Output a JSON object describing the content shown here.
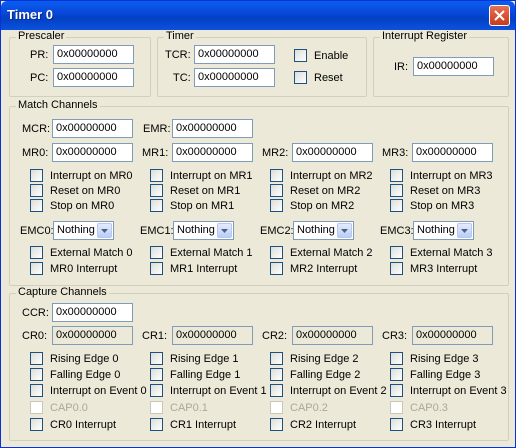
{
  "window": {
    "title": "Timer 0"
  },
  "prescaler": {
    "title": "Prescaler",
    "pr_label": "PR:",
    "pr_value": "0x00000000",
    "pc_label": "PC:",
    "pc_value": "0x00000000"
  },
  "timer": {
    "title": "Timer",
    "tcr_label": "TCR:",
    "tcr_value": "0x00000000",
    "tc_label": "TC:",
    "tc_value": "0x00000000",
    "enable_label": "Enable",
    "reset_label": "Reset"
  },
  "interrupt_register": {
    "title": "Interrupt Register",
    "ir_label": "IR:",
    "ir_value": "0x00000000"
  },
  "match": {
    "title": "Match Channels",
    "mcr_label": "MCR:",
    "mcr_value": "0x00000000",
    "emr_label": "EMR:",
    "emr_value": "0x00000000",
    "channels": [
      {
        "mr_label": "MR0:",
        "mr_value": "0x00000000",
        "int_label": "Interrupt on MR0",
        "reset_label": "Reset on MR0",
        "stop_label": "Stop on MR0",
        "emc_label": "EMC0:",
        "emc_value": "Nothing",
        "ext_label": "External Match 0",
        "mri_label": "MR0 Interrupt"
      },
      {
        "mr_label": "MR1:",
        "mr_value": "0x00000000",
        "int_label": "Interrupt on MR1",
        "reset_label": "Reset on MR1",
        "stop_label": "Stop on MR1",
        "emc_label": "EMC1:",
        "emc_value": "Nothing",
        "ext_label": "External Match 1",
        "mri_label": "MR1 Interrupt"
      },
      {
        "mr_label": "MR2:",
        "mr_value": "0x00000000",
        "int_label": "Interrupt on MR2",
        "reset_label": "Reset on MR2",
        "stop_label": "Stop on MR2",
        "emc_label": "EMC2:",
        "emc_value": "Nothing",
        "ext_label": "External Match 2",
        "mri_label": "MR2 Interrupt"
      },
      {
        "mr_label": "MR3:",
        "mr_value": "0x00000000",
        "int_label": "Interrupt on MR3",
        "reset_label": "Reset on MR3",
        "stop_label": "Stop on MR3",
        "emc_label": "EMC3:",
        "emc_value": "Nothing",
        "ext_label": "External Match 3",
        "mri_label": "MR3 Interrupt"
      }
    ]
  },
  "capture": {
    "title": "Capture Channels",
    "ccr_label": "CCR:",
    "ccr_value": "0x00000000",
    "channels": [
      {
        "cr_label": "CR0:",
        "cr_value": "0x00000000",
        "rise_label": "Rising Edge 0",
        "fall_label": "Falling Edge 0",
        "event_label": "Interrupt on Event 0",
        "cap_label": "CAP0.0",
        "cri_label": "CR0 Interrupt"
      },
      {
        "cr_label": "CR1:",
        "cr_value": "0x00000000",
        "rise_label": "Rising Edge 1",
        "fall_label": "Falling Edge 1",
        "event_label": "Interrupt on Event 1",
        "cap_label": "CAP0.1",
        "cri_label": "CR1 Interrupt"
      },
      {
        "cr_label": "CR2:",
        "cr_value": "0x00000000",
        "rise_label": "Rising Edge 2",
        "fall_label": "Falling Edge 2",
        "event_label": "Interrupt on Event 2",
        "cap_label": "CAP0.2",
        "cri_label": "CR2 Interrupt"
      },
      {
        "cr_label": "CR3:",
        "cr_value": "0x00000000",
        "rise_label": "Rising Edge 3",
        "fall_label": "Falling Edge 3",
        "event_label": "Interrupt on Event 3",
        "cap_label": "CAP0.3",
        "cri_label": "CR3 Interrupt"
      }
    ]
  },
  "colors": {
    "title_bar": "#0846d6",
    "dialog_bg": "#ece9d8",
    "close_button": "#c93b1a",
    "disabled_text": "#aca899"
  },
  "icons": {
    "close": "close-icon",
    "dropdown": "chevron-down-icon"
  }
}
